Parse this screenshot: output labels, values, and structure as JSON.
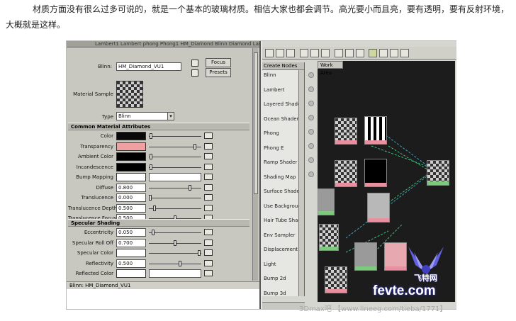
{
  "article": {
    "intro_line1": "材质方面没有很么过多可说的，就是一个基本的玻璃材质。相信大家也都会调节。高光要小而且亮，要有透明，要有反射环境，",
    "intro_line2": "大概就是这样。"
  },
  "attribute_editor": {
    "tabs_text": "Lambert1  Lambert  phong  Phong1 HM_Diamond Blinn Diamond Lambert",
    "name_label": "Blinn:",
    "name_value": "HM_Diamond_VU1",
    "focus_button": "Focus",
    "presets_button": "Presets",
    "sample_label": "Material Sample",
    "type_label": "Type",
    "type_value": "Blinn",
    "common_section": "Common Material Attributes",
    "common_rows": [
      {
        "label": "Color",
        "swatch": "#0a0a0a",
        "knob": 0.02
      },
      {
        "label": "Transparency",
        "swatch": "#f0a0a0",
        "knob": 0.9
      },
      {
        "label": "Ambient Color",
        "swatch": "#000000",
        "knob": 0.02
      },
      {
        "label": "Incandescence",
        "swatch": "#000000",
        "knob": 0.02
      },
      {
        "label": "Bump Mapping",
        "swatch": "#ffffff",
        "knob": null
      },
      {
        "label": "Diffuse",
        "value": "0.800",
        "knob": 0.8
      },
      {
        "label": "Translucence",
        "value": "0.000",
        "knob": 0.0
      },
      {
        "label": "Translucence Depth",
        "value": "0.500",
        "knob": 0.08
      },
      {
        "label": "Translucence Focus",
        "value": "0.500",
        "knob": 0.5
      }
    ],
    "specular_section": "Specular Shading",
    "specular_rows": [
      {
        "label": "Eccentricity",
        "value": "0.050",
        "knob": 0.05
      },
      {
        "label": "Specular Roll Off",
        "value": "0.700",
        "knob": 0.5
      },
      {
        "label": "Specular Color",
        "swatch": "#ffffff",
        "knob": 0.98
      },
      {
        "label": "Reflectivity",
        "value": "0.500",
        "knob": 0.6
      },
      {
        "label": "Reflected Color",
        "swatch": "#ffffff",
        "knob": null
      }
    ],
    "footer": "Blinn: HM_Diamond_VU1"
  },
  "hypershade": {
    "create_panel_header": "Create Nodes",
    "create_items": [
      "Blinn",
      "Lambert",
      "Layered Shader",
      "Ocean Shader",
      "Phong",
      "Phong E",
      "Ramp Shader",
      "Shading Map",
      "Surface Shader",
      "Use Background",
      "Hair Tube Shader",
      "Env Sampler",
      "Displacement",
      "Light",
      "Bump 2d",
      "Bump 3d"
    ],
    "work_tab": "Work Area"
  },
  "watermark": {
    "name": "飞特网",
    "site": "fevte.com",
    "credit": "3Dmax吧 【www.lineeg.com/tieba/1771】"
  },
  "colors": {
    "node_green": "#7ec97e",
    "node_pink": "#e890a0",
    "link_green": "#40c080",
    "link_cyan": "#40a0c0"
  }
}
